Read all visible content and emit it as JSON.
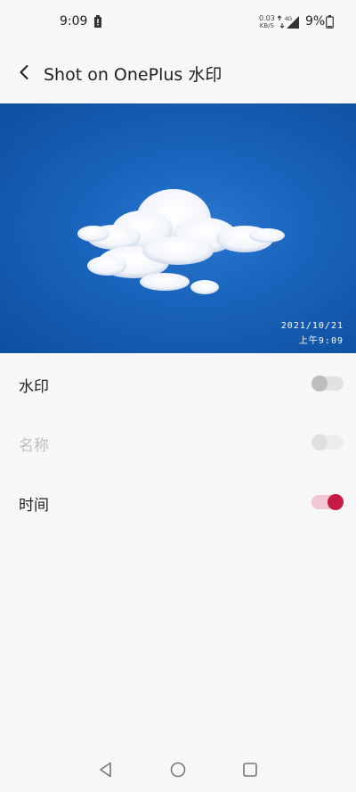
{
  "status_bar": {
    "time": "9:09",
    "net_speed_value": "0.03",
    "net_speed_unit": "KB/S",
    "network_type": "4G",
    "battery_percent": "9%"
  },
  "header": {
    "title": "Shot on OnePlus 水印"
  },
  "preview": {
    "watermark_date": "2021/10/21",
    "watermark_time": "上午9:09"
  },
  "settings": [
    {
      "label": "水印",
      "enabled": true,
      "on": false
    },
    {
      "label": "名称",
      "enabled": false,
      "on": false
    },
    {
      "label": "时间",
      "enabled": true,
      "on": true
    }
  ],
  "colors": {
    "accent": "#c81945",
    "sky": "#1a64bd",
    "background": "#f7f7f7"
  },
  "icons": {
    "back": "back-arrow-icon",
    "nav_back": "triangle-back-icon",
    "nav_home": "circle-home-icon",
    "nav_recents": "square-recents-icon"
  }
}
